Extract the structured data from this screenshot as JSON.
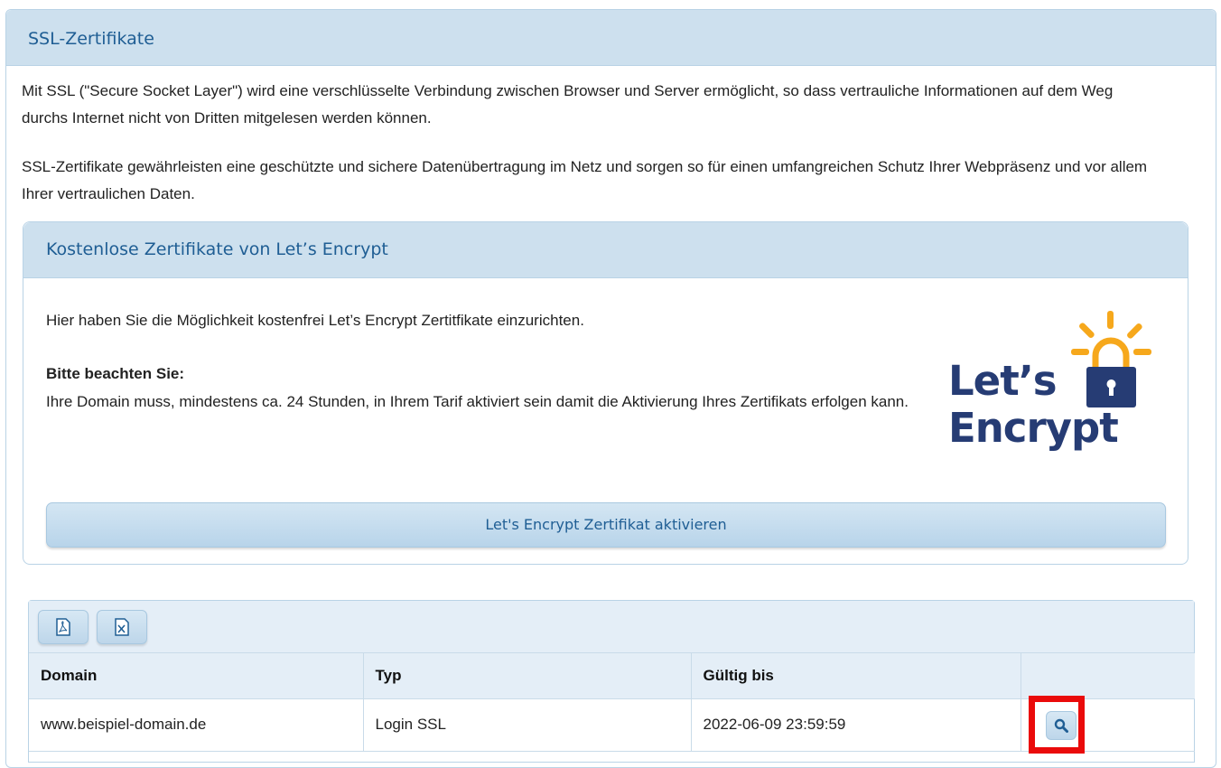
{
  "panel": {
    "title": "SSL-Zertifikate",
    "intro1": "Mit SSL (\"Secure Socket Layer\") wird eine verschlüsselte Verbindung zwischen Browser und Server ermöglicht, so dass vertrauliche Informationen auf dem Weg durchs Internet nicht von Dritten mitgelesen werden können.",
    "intro2": "SSL-Zertifikate gewährleisten eine geschützte und sichere Datenübertragung im Netz und sorgen so für einen umfangreichen Schutz Ihrer Webpräsenz und vor allem Ihrer vertraulichen Daten."
  },
  "letsencrypt": {
    "title": "Kostenlose Zertifikate von Let’s Encrypt",
    "text": "Hier haben Sie die Möglichkeit kostenfrei Let’s Encrypt Zertitfikate einzurichten.",
    "note_title": "Bitte beachten Sie:",
    "note": "Ihre Domain muss, mindestens ca. 24 Stunden, in Ihrem Tarif aktiviert sein damit die Aktivierung Ihres Zertifikats erfolgen kann.",
    "logo_line1": "Let’s",
    "logo_line2": "Encrypt",
    "button_label": "Let's Encrypt Zertifikat aktivieren"
  },
  "table": {
    "toolbar": {
      "pdf_icon": "file-pdf-icon",
      "excel_icon": "file-excel-icon"
    },
    "headers": [
      "Domain",
      "Typ",
      "Gültig bis",
      ""
    ],
    "rows": [
      {
        "domain": "www.beispiel-domain.de",
        "typ": "Login SSL",
        "gueltig_bis": "2022-06-09 23:59:59",
        "action_icon": "search-icon"
      }
    ]
  },
  "colors": {
    "header_bg": "#cde0ee",
    "header_text": "#1f5e94",
    "logo_blue": "#263c74",
    "logo_orange": "#f6a81c",
    "highlight": "#ea0b0b"
  }
}
